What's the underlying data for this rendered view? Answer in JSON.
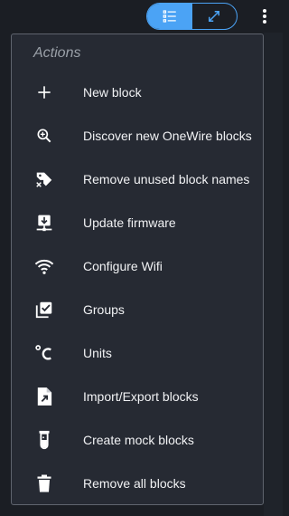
{
  "toolbar": {
    "list_view_icon": "list-icon",
    "expand_icon": "expand-diagonal-icon",
    "more_icon": "more-vertical-icon",
    "accent_color": "#4ba3f5"
  },
  "menu": {
    "title": "Actions",
    "items": [
      {
        "label": "New block",
        "icon": "plus-icon"
      },
      {
        "label": "Discover new OneWire blocks",
        "icon": "zoom-plus-icon"
      },
      {
        "label": "Remove unused block names",
        "icon": "tag-remove-icon"
      },
      {
        "label": "Update firmware",
        "icon": "download-network-icon"
      },
      {
        "label": "Configure Wifi",
        "icon": "wifi-icon"
      },
      {
        "label": "Groups",
        "icon": "checkbox-multiple-icon"
      },
      {
        "label": "Units",
        "icon": "temperature-celsius-icon"
      },
      {
        "label": "Import/Export blocks",
        "icon": "file-export-icon"
      },
      {
        "label": "Create mock blocks",
        "icon": "test-tube-icon"
      },
      {
        "label": "Remove all blocks",
        "icon": "trash-icon"
      }
    ]
  }
}
